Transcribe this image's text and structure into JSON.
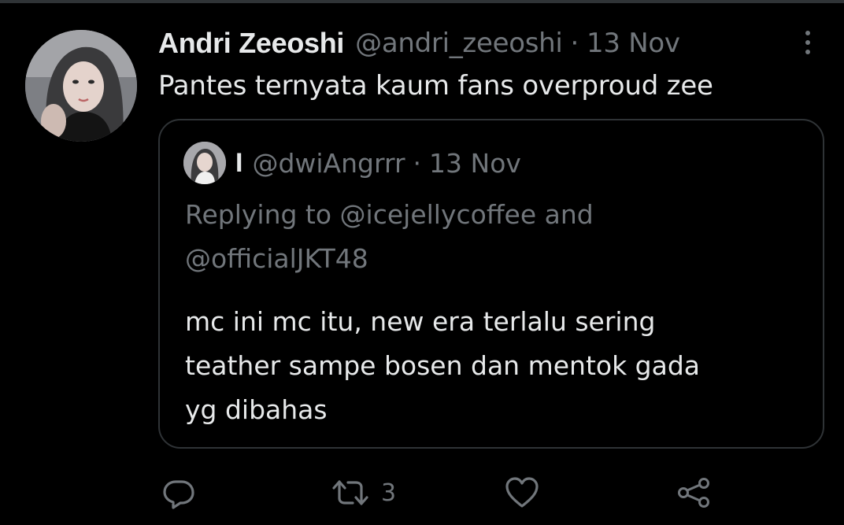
{
  "tweet": {
    "author_name": "Andri Zeeoshi",
    "author_handle": "@andri_zeeoshi",
    "separator": "·",
    "date": "13 Nov",
    "text": "Pantes ternyata kaum fans overproud zee"
  },
  "quoted_tweet": {
    "author_name": "I",
    "author_handle": "@dwiAngrrr",
    "separator": "·",
    "date": "13 Nov",
    "replying_line1": "Replying to @icejellycoffee and",
    "replying_line2": "@officialJKT48",
    "text_line1": "mc ini mc itu, new era terlalu sering",
    "text_line2": "teather sampe bosen dan mentok gada",
    "text_line3": "yg dibahas"
  },
  "actions": {
    "reply_icon": "reply-icon",
    "retweet_icon": "retweet-icon",
    "retweet_count": "3",
    "like_icon": "heart-icon",
    "share_icon": "share-icon"
  },
  "colors": {
    "background": "#000000",
    "text_primary": "#e7e9ea",
    "text_secondary": "#71767b",
    "border": "#2f3336"
  }
}
